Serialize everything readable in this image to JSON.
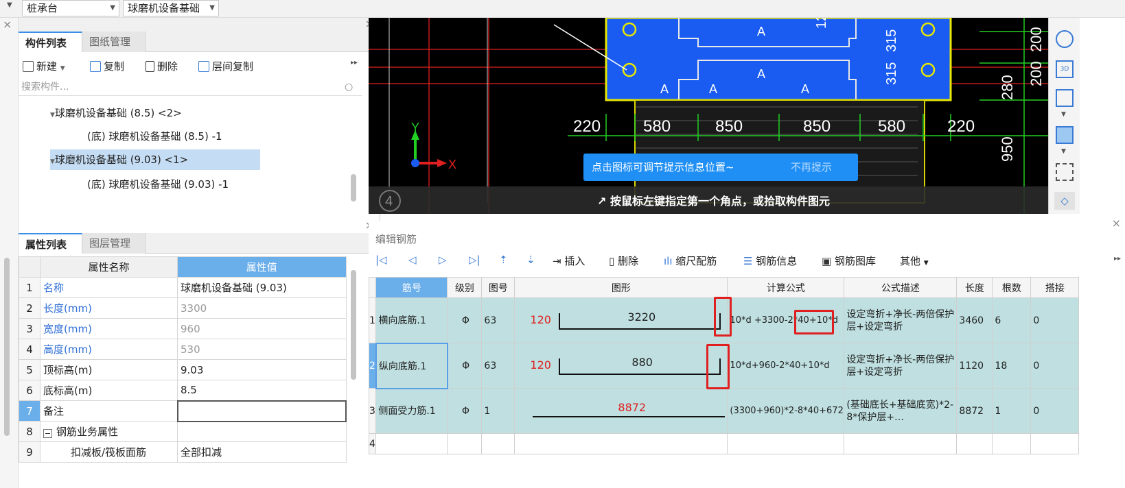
{
  "topbar": {
    "select1": "桩承台",
    "select2": "球磨机设备基础"
  },
  "components_panel": {
    "tabs": [
      "构件列表",
      "图纸管理"
    ],
    "toolbar": {
      "new": "新建",
      "copy": "复制",
      "delete": "删除",
      "floor_copy": "层间复制"
    },
    "search_placeholder": "搜索构件...",
    "tree": [
      "球磨机设备基础 (8.5)  <2>",
      "(底) 球磨机设备基础 (8.5) -1",
      "球磨机设备基础 (9.03)  <1>",
      "(底) 球磨机设备基础 (9.03) -1"
    ]
  },
  "properties_panel": {
    "tabs": [
      "属性列表",
      "图层管理"
    ],
    "headers": {
      "name": "属性名称",
      "value": "属性值"
    },
    "rows": [
      {
        "n": "1",
        "name": "名称",
        "value": "球磨机设备基础 (9.03)"
      },
      {
        "n": "2",
        "name": "长度(mm)",
        "value": "3300"
      },
      {
        "n": "3",
        "name": "宽度(mm)",
        "value": "960"
      },
      {
        "n": "4",
        "name": "高度(mm)",
        "value": "530"
      },
      {
        "n": "5",
        "name": "顶标高(m)",
        "value": "9.03"
      },
      {
        "n": "6",
        "name": "底标高(m)",
        "value": "8.5"
      },
      {
        "n": "7",
        "name": "备注",
        "value": ""
      },
      {
        "n": "8",
        "name": "钢筋业务属性",
        "value": ""
      },
      {
        "n": "9",
        "name": "扣减板/筏板面筋",
        "value": "全部扣减"
      }
    ]
  },
  "cad": {
    "dims": [
      "220",
      "580",
      "850",
      "850",
      "580",
      "220"
    ],
    "right_dims": [
      "200",
      "200",
      "280",
      "950"
    ],
    "labels": [
      "A",
      "A",
      "A",
      "A",
      "A"
    ],
    "vert": [
      "315",
      "315",
      "12"
    ],
    "axis_x": "X",
    "axis_y": "Y",
    "circle_num": "4",
    "tip": "点击图标可调节提示信息位置~",
    "tip_dismiss": "不再提示",
    "status": "按鼠标左键指定第一个角点，或拾取构件图元"
  },
  "rebar": {
    "title": "编辑钢筋",
    "toolbar": {
      "insert": "插入",
      "delete": "删除",
      "scale": "缩尺配筋",
      "info": "钢筋信息",
      "library": "钢筋图库",
      "other": "其他"
    },
    "headers": [
      "筋号",
      "级别",
      "图号",
      "图形",
      "计算公式",
      "公式描述",
      "长度",
      "根数",
      "搭接"
    ],
    "rows": [
      {
        "n": "1",
        "name": "横向底筋.1",
        "grade": "Φ",
        "fig": "63",
        "left": "120",
        "mid": "3220",
        "formula": "10*d +3300-2*40+10*d",
        "desc": "设定弯折+净长-两倍保护层+设定弯折",
        "len": "3460",
        "count": "6",
        "lap": "0"
      },
      {
        "n": "2",
        "name": "纵向底筋.1",
        "grade": "Φ",
        "fig": "63",
        "left": "120",
        "mid": "880",
        "formula": "10*d+960-2*40+10*d",
        "desc": "设定弯折+净长-两倍保护层+设定弯折",
        "len": "1120",
        "count": "18",
        "lap": "0"
      },
      {
        "n": "3",
        "name": "侧面受力筋.1",
        "grade": "Φ",
        "fig": "1",
        "left": "",
        "mid": "8872",
        "formula": "(3300+960)*2-8*40+672",
        "desc": "(基础底长+基础底宽)*2-8*保护层+…",
        "len": "8872",
        "count": "1",
        "lap": "0"
      },
      {
        "n": "4",
        "name": "",
        "grade": "",
        "fig": "",
        "left": "",
        "mid": "",
        "formula": "",
        "desc": "",
        "len": "",
        "count": "",
        "lap": ""
      }
    ]
  }
}
